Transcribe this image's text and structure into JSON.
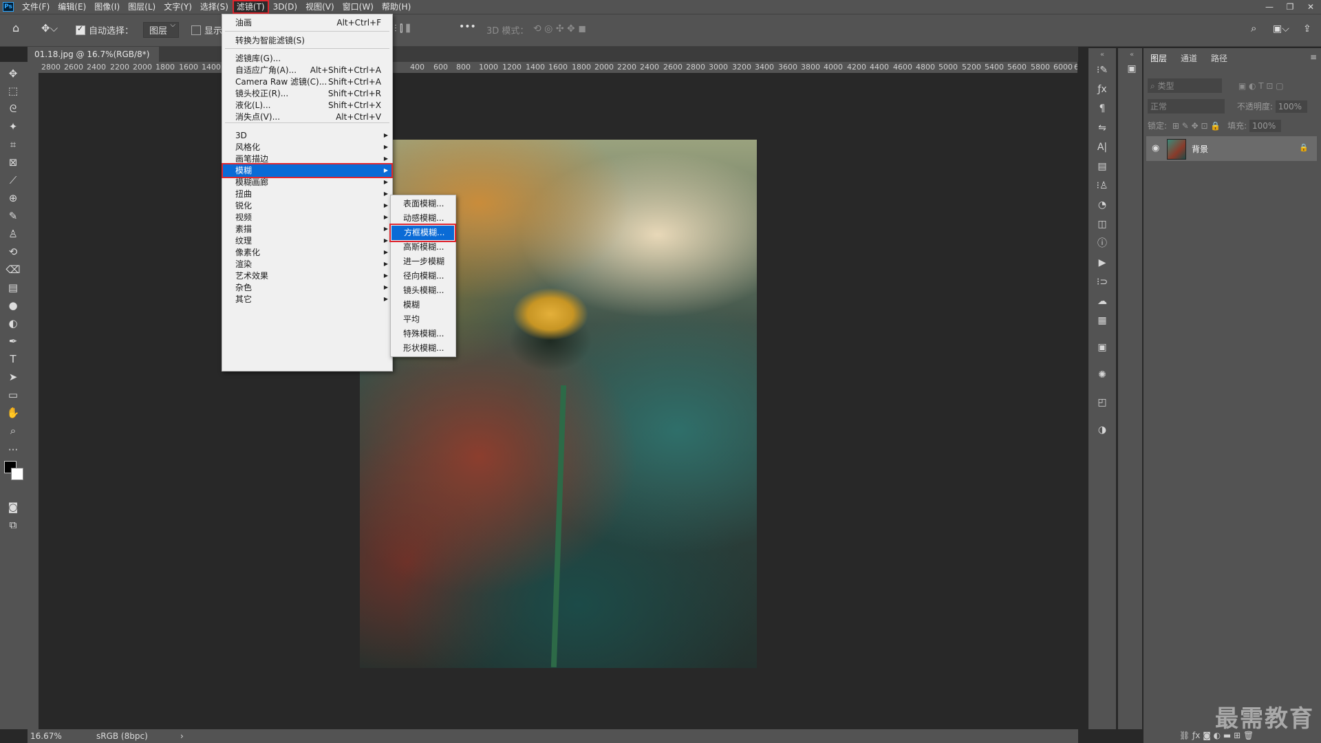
{
  "menubar": {
    "logo": "Ps",
    "items": [
      "文件(F)",
      "编辑(E)",
      "图像(I)",
      "图层(L)",
      "文字(Y)",
      "选择(S)",
      "滤镜(T)",
      "3D(D)",
      "视图(V)",
      "窗口(W)",
      "帮助(H)"
    ]
  },
  "window_controls": [
    "—",
    "❐",
    "✕"
  ],
  "options": {
    "auto_select_label": "自动选择：",
    "auto_select_value": "图层",
    "show_label": "显示",
    "mode_label": "3D 模式："
  },
  "document": {
    "tab_title": "01.18.jpg @ 16.7%(RGB/8*)",
    "tab_close": "×"
  },
  "ruler": {
    "h_ticks": [
      "2800",
      "2600",
      "2400",
      "2200",
      "2000",
      "1800",
      "1600",
      "1400",
      "400",
      "600",
      "800",
      "1000",
      "1200",
      "1400",
      "1600",
      "1800",
      "2000",
      "2200",
      "2400",
      "2600",
      "2800",
      "3000",
      "3200",
      "3400",
      "3600",
      "3800",
      "4000",
      "4200",
      "4400",
      "4600",
      "4800",
      "5000",
      "5200",
      "5400",
      "5600",
      "5800",
      "6000",
      "6"
    ]
  },
  "filter_menu": {
    "items": [
      {
        "label": "油画",
        "shortcut": "Alt+Ctrl+F"
      },
      {
        "label": "转换为智能滤镜(S)",
        "shortcut": ""
      },
      {
        "label": "滤镜库(G)...",
        "shortcut": ""
      },
      {
        "label": "自适应广角(A)...",
        "shortcut": "Alt+Shift+Ctrl+A"
      },
      {
        "label": "Camera Raw 滤镜(C)...",
        "shortcut": "Shift+Ctrl+A"
      },
      {
        "label": "镜头校正(R)...",
        "shortcut": "Shift+Ctrl+R"
      },
      {
        "label": "液化(L)...",
        "shortcut": "Shift+Ctrl+X"
      },
      {
        "label": "消失点(V)...",
        "shortcut": "Alt+Ctrl+V"
      },
      {
        "label": "3D"
      },
      {
        "label": "风格化"
      },
      {
        "label": "画笔描边"
      },
      {
        "label": "模糊"
      },
      {
        "label": "模糊画廊"
      },
      {
        "label": "扭曲"
      },
      {
        "label": "锐化"
      },
      {
        "label": "视频"
      },
      {
        "label": "素描"
      },
      {
        "label": "纹理"
      },
      {
        "label": "像素化"
      },
      {
        "label": "渲染"
      },
      {
        "label": "艺术效果"
      },
      {
        "label": "杂色"
      },
      {
        "label": "其它"
      }
    ]
  },
  "blur_submenu": {
    "items": [
      "表面模糊...",
      "动感模糊...",
      "方框模糊...",
      "高斯模糊...",
      "进一步模糊",
      "径向模糊...",
      "镜头模糊...",
      "模糊",
      "平均",
      "特殊模糊...",
      "形状模糊..."
    ]
  },
  "layers_panel": {
    "tabs": [
      "图层",
      "通道",
      "路径"
    ],
    "filter_placeholder": "类型",
    "blend_mode": "正常",
    "opacity_label": "不透明度:",
    "opacity_value": "100%",
    "lock_label": "锁定:",
    "fill_label": "填充:",
    "fill_value": "100%",
    "layer_name": "背景"
  },
  "status": {
    "zoom": "16.67%",
    "color_profile": "sRGB (8bpc)",
    "arrow": "›"
  },
  "watermark": "最需教育",
  "colors": {
    "highlight": "#0a6bd6",
    "annotation": "#e0262e"
  }
}
